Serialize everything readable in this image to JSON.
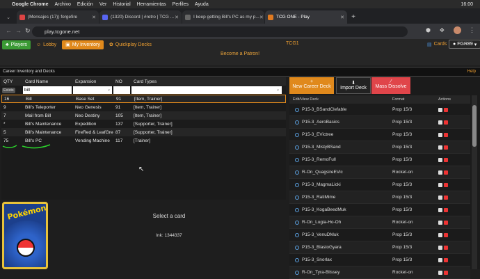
{
  "mac": {
    "app": "Google Chrome",
    "menus": [
      "Archivo",
      "Edición",
      "Ver",
      "Historial",
      "Herramientas",
      "Perfiles",
      "Ayuda"
    ],
    "time": "16:00"
  },
  "tabs": [
    {
      "label": "(Mensajes (17)) forgefire",
      "color": "#d44"
    },
    {
      "label": "(1320) Discord | #retro | TCG ...",
      "color": "#5865f2"
    },
    {
      "label": "I keep getting Bill's PC as my p...",
      "color": "#666"
    },
    {
      "label": "TCG ONE - Play",
      "color": "#e07a20"
    }
  ],
  "url": "play.tcgone.net",
  "nav": {
    "players": "Players",
    "lobby": "Lobby",
    "inventory": "My Inventory",
    "quickplay": "Quickplay Decks",
    "center": "TCG1",
    "cards": "Cards",
    "user": "FGR89"
  },
  "patron": "Become a Patron!",
  "section": {
    "title": "Career Inventory and Decks",
    "help": "Help"
  },
  "table": {
    "headers": [
      "QTY",
      "Card Name",
      "Expansion",
      "NO",
      "Card Types"
    ],
    "filter": {
      "qty": "Exists",
      "name": "bill"
    },
    "rows": [
      {
        "qty": "16",
        "name": "Bill",
        "exp": "Base Set",
        "no": "91",
        "types": "[Item, Trainer]"
      },
      {
        "qty": "9",
        "name": "Bill's Teleporter",
        "exp": "Neo Genesis",
        "no": "91",
        "types": "[Item, Trainer]"
      },
      {
        "qty": "7",
        "name": "Mail from Bill",
        "exp": "Neo Destiny",
        "no": "105",
        "types": "[Item, Trainer]"
      },
      {
        "qty": "*",
        "name": "Bill's Maintenance",
        "exp": "Expedition",
        "no": "137",
        "types": "[Supporter, Trainer]"
      },
      {
        "qty": "5",
        "name": "Bill's Maintenance",
        "exp": "FireRed & LeafGree",
        "no": "87",
        "types": "[Supporter, Trainer]"
      },
      {
        "qty": "75",
        "name": "Bill's PC",
        "exp": "Vending Machine",
        "no": "117",
        "types": "[Trainer]"
      }
    ]
  },
  "select_card": "Select a card",
  "ink": "Ink: 1344337",
  "actions": {
    "new_deck": "New Career Deck",
    "import_deck": "Import Deck",
    "dissolve": "Mass Dissolve"
  },
  "decks_header": [
    "Edit/View Deck",
    "Format",
    "Actions"
  ],
  "decks": [
    {
      "name": "P15-3_BSandClefable",
      "format": "Prop 15/3"
    },
    {
      "name": "P15-3_AeroBasics",
      "format": "Prop 15/3"
    },
    {
      "name": "P15-3_EVictree",
      "format": "Prop 15/3"
    },
    {
      "name": "P15-3_MistyBSand",
      "format": "Prop 15/3"
    },
    {
      "name": "P15-3_RemoFull",
      "format": "Prop 15/3"
    },
    {
      "name": "R-On_QuagsireEVic",
      "format": "Rocket-on"
    },
    {
      "name": "P15-3_MagmaLicki",
      "format": "Prop 15/3"
    },
    {
      "name": "P15-3_RatiMime",
      "format": "Prop 15/3"
    },
    {
      "name": "P15-3_KogaBeedMuk",
      "format": "Prop 15/3"
    },
    {
      "name": "R-On_Lugia-Ho-Oh",
      "format": "Rocket-on"
    },
    {
      "name": "P15-3_VenuDMuk",
      "format": "Prop 15/3"
    },
    {
      "name": "P15-3_BlastoGyara",
      "format": "Prop 15/3"
    },
    {
      "name": "P15-3_Snorlax",
      "format": "Prop 15/3"
    },
    {
      "name": "R-On_Tyra-Blissey",
      "format": "Rocket-on"
    }
  ]
}
